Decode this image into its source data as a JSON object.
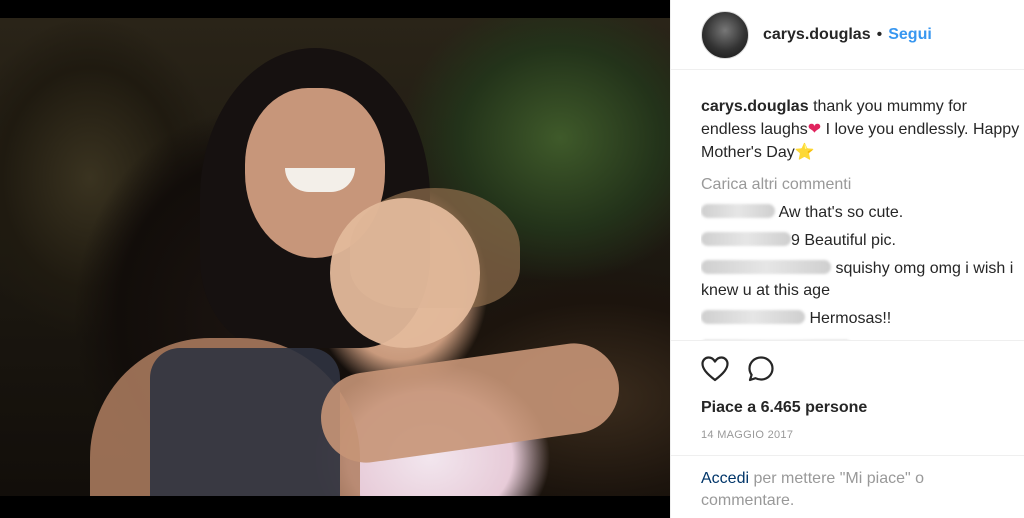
{
  "header": {
    "username": "carys.douglas",
    "separator": "•",
    "follow_label": "Segui",
    "avatar_icon": "profile-avatar"
  },
  "caption": {
    "username": "carys.douglas",
    "text_part1": "thank you mummy for endless laughs",
    "heart_emoji": "❤",
    "text_part2": " I love you endlessly. Happy Mother's Day",
    "star_emoji": "⭐"
  },
  "load_more_label": "Carica altri commenti",
  "comments": [
    {
      "text": "Aw that's so cute."
    },
    {
      "text": "9 Beautiful pic."
    },
    {
      "text": "squishy omg omg i wish i knew u at this age"
    },
    {
      "text": "Hermosas!!"
    }
  ],
  "actions": {
    "like_icon": "heart-outline-icon",
    "comment_icon": "speech-bubble-icon",
    "likes_text": "Piace a 6.465 persone",
    "date_text": "14 MAGGIO 2017"
  },
  "login_prompt": {
    "link_label": "Accedi",
    "rest_text": " per mettere \"Mi piace\" o commentare."
  },
  "colors": {
    "accent_blue": "#3897f0",
    "text": "#262626",
    "muted": "#999999",
    "heart": "#e0245e",
    "star": "#f5c518"
  }
}
